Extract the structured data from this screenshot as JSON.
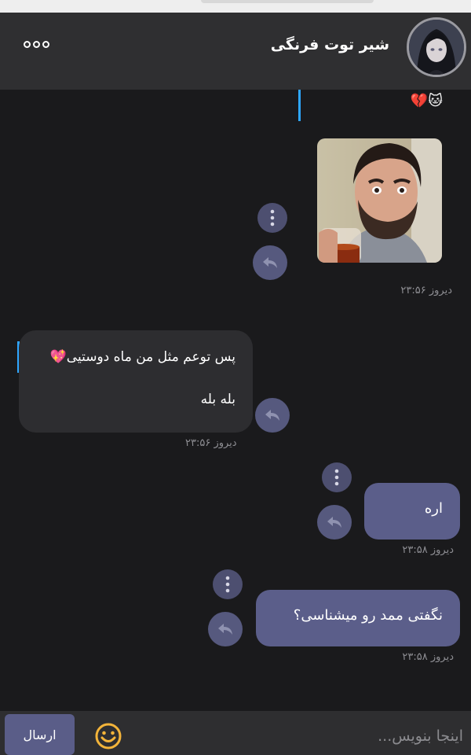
{
  "header": {
    "contact_name": "شیر توت فرنگی",
    "more_icon": "more-horizontal-icon",
    "avatar_icon": "avatar"
  },
  "messages": [
    {
      "type": "emoji",
      "text": "💔🐱"
    },
    {
      "type": "image",
      "direction": "outgoing",
      "description_icon": "photo-image",
      "time": "دیروز ۲۳:۵۶"
    },
    {
      "type": "text",
      "direction": "incoming",
      "line1": "پس توعم مثل من ماه دوستیی💖",
      "line2": "بله بله",
      "time": "دیروز ۲۳:۵۶"
    },
    {
      "type": "text",
      "direction": "outgoing",
      "text": "اره",
      "time": "دیروز ۲۳:۵۸"
    },
    {
      "type": "text",
      "direction": "outgoing",
      "text": "نگفتی ممد رو میشناسی؟",
      "time": "دیروز ۲۳:۵۸"
    }
  ],
  "composer": {
    "placeholder": "اینجا بنویس...",
    "send_label": "ارسال",
    "emoji_icon": "smiley-icon"
  },
  "colors": {
    "background": "#1a1a1c",
    "header": "#2f2f31",
    "outgoing_bubble": "#5b5e8a",
    "incoming_bubble": "#2d2d30",
    "reply_line": "#2ea6ff"
  }
}
